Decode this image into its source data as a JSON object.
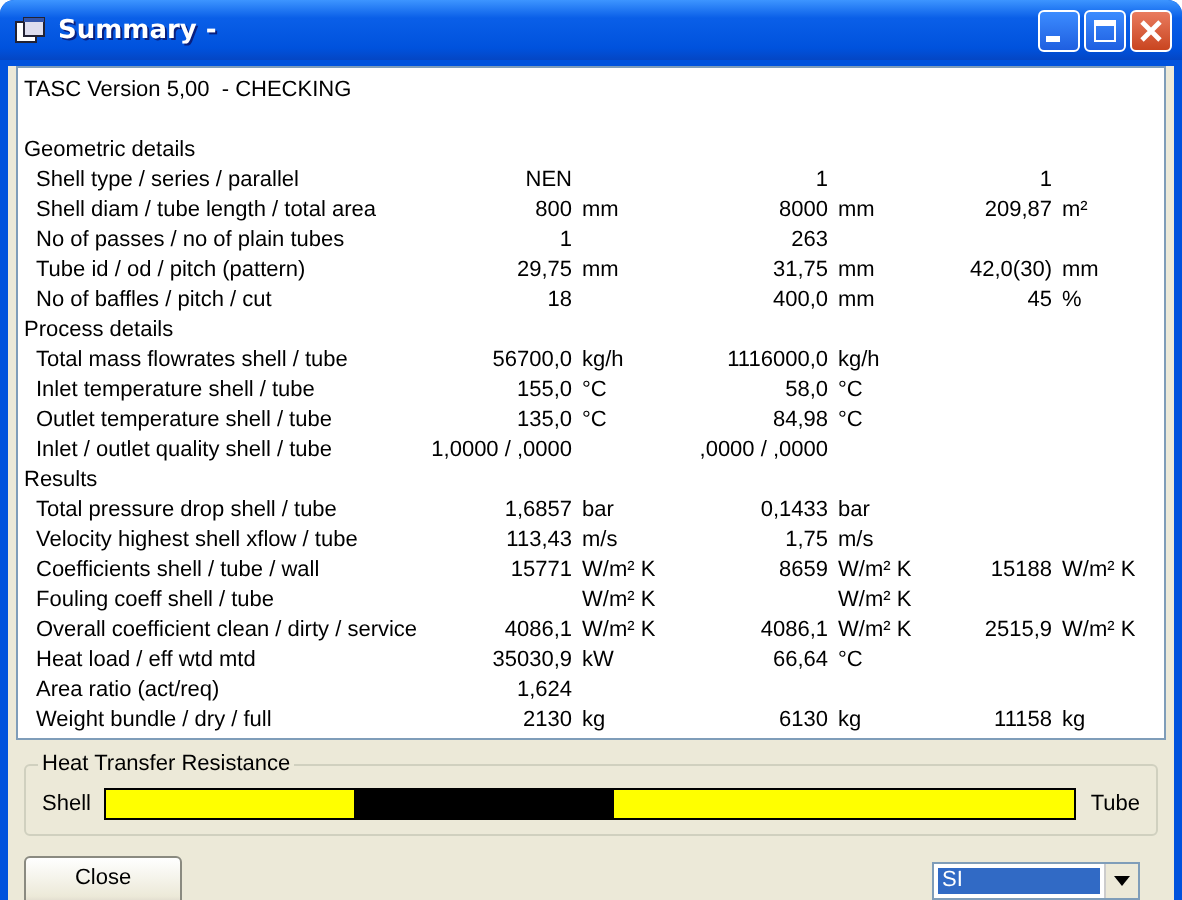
{
  "window": {
    "title": "Summary -"
  },
  "header": "TASC Version 5,00  - CHECKING",
  "sections": [
    {
      "title": "Geometric details",
      "rows": [
        {
          "label": "Shell type / series / parallel",
          "col_1": {
            "value": "NEN"
          },
          "col_2": {
            "value": "1"
          },
          "col_3": {
            "value": "1"
          }
        },
        {
          "label": "Shell diam / tube length / total area",
          "col_1": {
            "value": "800",
            "unit": "mm"
          },
          "col_2": {
            "value": "8000",
            "unit": "mm"
          },
          "col_3": {
            "value": "209,87",
            "unit": "m²"
          }
        },
        {
          "label": "No of passes / no of plain tubes",
          "col_1": {
            "value": "1"
          },
          "col_2": {
            "value": "263"
          }
        },
        {
          "label": "Tube id / od / pitch (pattern)",
          "col_1": {
            "value": "29,75",
            "unit": "mm"
          },
          "col_2": {
            "value": "31,75",
            "unit": "mm"
          },
          "col_3": {
            "value": "42,0(30)",
            "unit": "mm"
          }
        },
        {
          "label": "No of baffles / pitch / cut",
          "col_1": {
            "value": "18"
          },
          "col_2": {
            "value": "400,0",
            "unit": "mm"
          },
          "col_3": {
            "value": "45",
            "unit": "%"
          }
        }
      ]
    },
    {
      "title": "Process details",
      "rows": [
        {
          "label": "Total mass flowrates shell / tube",
          "col_1": {
            "value": "56700,0",
            "unit": "kg/h"
          },
          "col_2": {
            "value": "1116000,0",
            "unit": "kg/h"
          }
        },
        {
          "label": "Inlet temperature shell / tube",
          "col_1": {
            "value": "155,0",
            "unit": "°C"
          },
          "col_2": {
            "value": "58,0",
            "unit": "°C"
          }
        },
        {
          "label": "Outlet temperature shell / tube",
          "col_1": {
            "value": "135,0",
            "unit": "°C"
          },
          "col_2": {
            "value": "84,98",
            "unit": "°C"
          }
        },
        {
          "label": "Inlet / outlet quality shell / tube",
          "col_1": {
            "value": "1,0000 / ,0000"
          },
          "col_2": {
            "value": ",0000 / ,0000"
          }
        }
      ]
    },
    {
      "title": "Results",
      "rows": [
        {
          "label": "Total pressure drop shell / tube",
          "col_1": {
            "value": "1,6857",
            "unit": "bar"
          },
          "col_2": {
            "value": "0,1433",
            "unit": "bar"
          }
        },
        {
          "label": "Velocity highest shell xflow / tube",
          "col_1": {
            "value": "113,43",
            "unit": "m/s"
          },
          "col_2": {
            "value": "1,75",
            "unit": "m/s"
          }
        },
        {
          "label": "Coefficients shell / tube / wall",
          "col_1": {
            "value": "15771",
            "unit": "W/m² K"
          },
          "col_2": {
            "value": "8659",
            "unit": "W/m² K"
          },
          "col_3": {
            "value": "15188",
            "unit": "W/m² K"
          }
        },
        {
          "label": "Fouling coeff shell / tube",
          "col_1": {
            "unit": "W/m² K"
          },
          "col_2": {
            "unit": "W/m² K"
          }
        },
        {
          "label": "Overall coefficient clean / dirty / service",
          "col_1": {
            "value": "4086,1",
            "unit": "W/m² K"
          },
          "col_2": {
            "value": "4086,1",
            "unit": "W/m² K"
          },
          "col_3": {
            "value": "2515,9",
            "unit": "W/m² K"
          }
        },
        {
          "label": "Heat load / eff wtd mtd",
          "col_1": {
            "value": "35030,9",
            "unit": "kW"
          },
          "col_2": {
            "value": "66,64",
            "unit": "°C"
          }
        },
        {
          "label": "Area ratio (act/req)",
          "col_1": {
            "value": "1,624"
          }
        },
        {
          "label": "Weight bundle / dry / full",
          "col_1": {
            "value": "2130",
            "unit": "kg"
          },
          "col_2": {
            "value": "6130",
            "unit": "kg"
          },
          "col_3": {
            "value": "11158",
            "unit": "kg"
          }
        }
      ]
    }
  ],
  "resistance": {
    "title": "Heat Transfer Resistance",
    "left_label": "Shell",
    "right_label": "Tube",
    "fills": [
      {
        "level": 0.524,
        "color": "#000000"
      },
      {
        "level": 0.256,
        "color": "#ffff00"
      }
    ]
  },
  "close_button": "Close",
  "units_select": {
    "value": "SI"
  }
}
